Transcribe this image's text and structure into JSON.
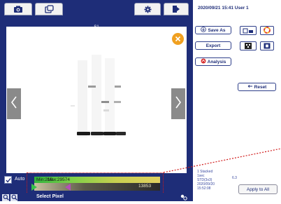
{
  "tabs": [
    {
      "icon": "camera-icon"
    },
    {
      "icon": "copy-icon"
    }
  ],
  "toolbar_icons": [
    "gear-icon",
    "exit-icon"
  ],
  "viewport": {
    "title": "S1",
    "close_icon": "close-icon"
  },
  "header": {
    "datetime": "2020/09/21 15:41",
    "user": "User 1"
  },
  "buttons": {
    "save_as": "Save As",
    "export": "Export",
    "analysis": "Analysis",
    "reset": "Reset",
    "apply_all": "Apply to All"
  },
  "auto_label": "Auto",
  "histogram": {
    "min_label": "Min:218",
    "max_label": "Max:29574",
    "value_label": "13853"
  },
  "bottom": {
    "select_pixel": "Select Pixel"
  },
  "info": {
    "lines": [
      "1 Stacked",
      "1sec",
      "STD(3x3)",
      "2020/09/20",
      "15:52:08"
    ],
    "value": "6.3"
  },
  "colors": {
    "frame": "#1e2d78",
    "accent_orange": "#f0a020",
    "annotation_red": "#d01818"
  }
}
